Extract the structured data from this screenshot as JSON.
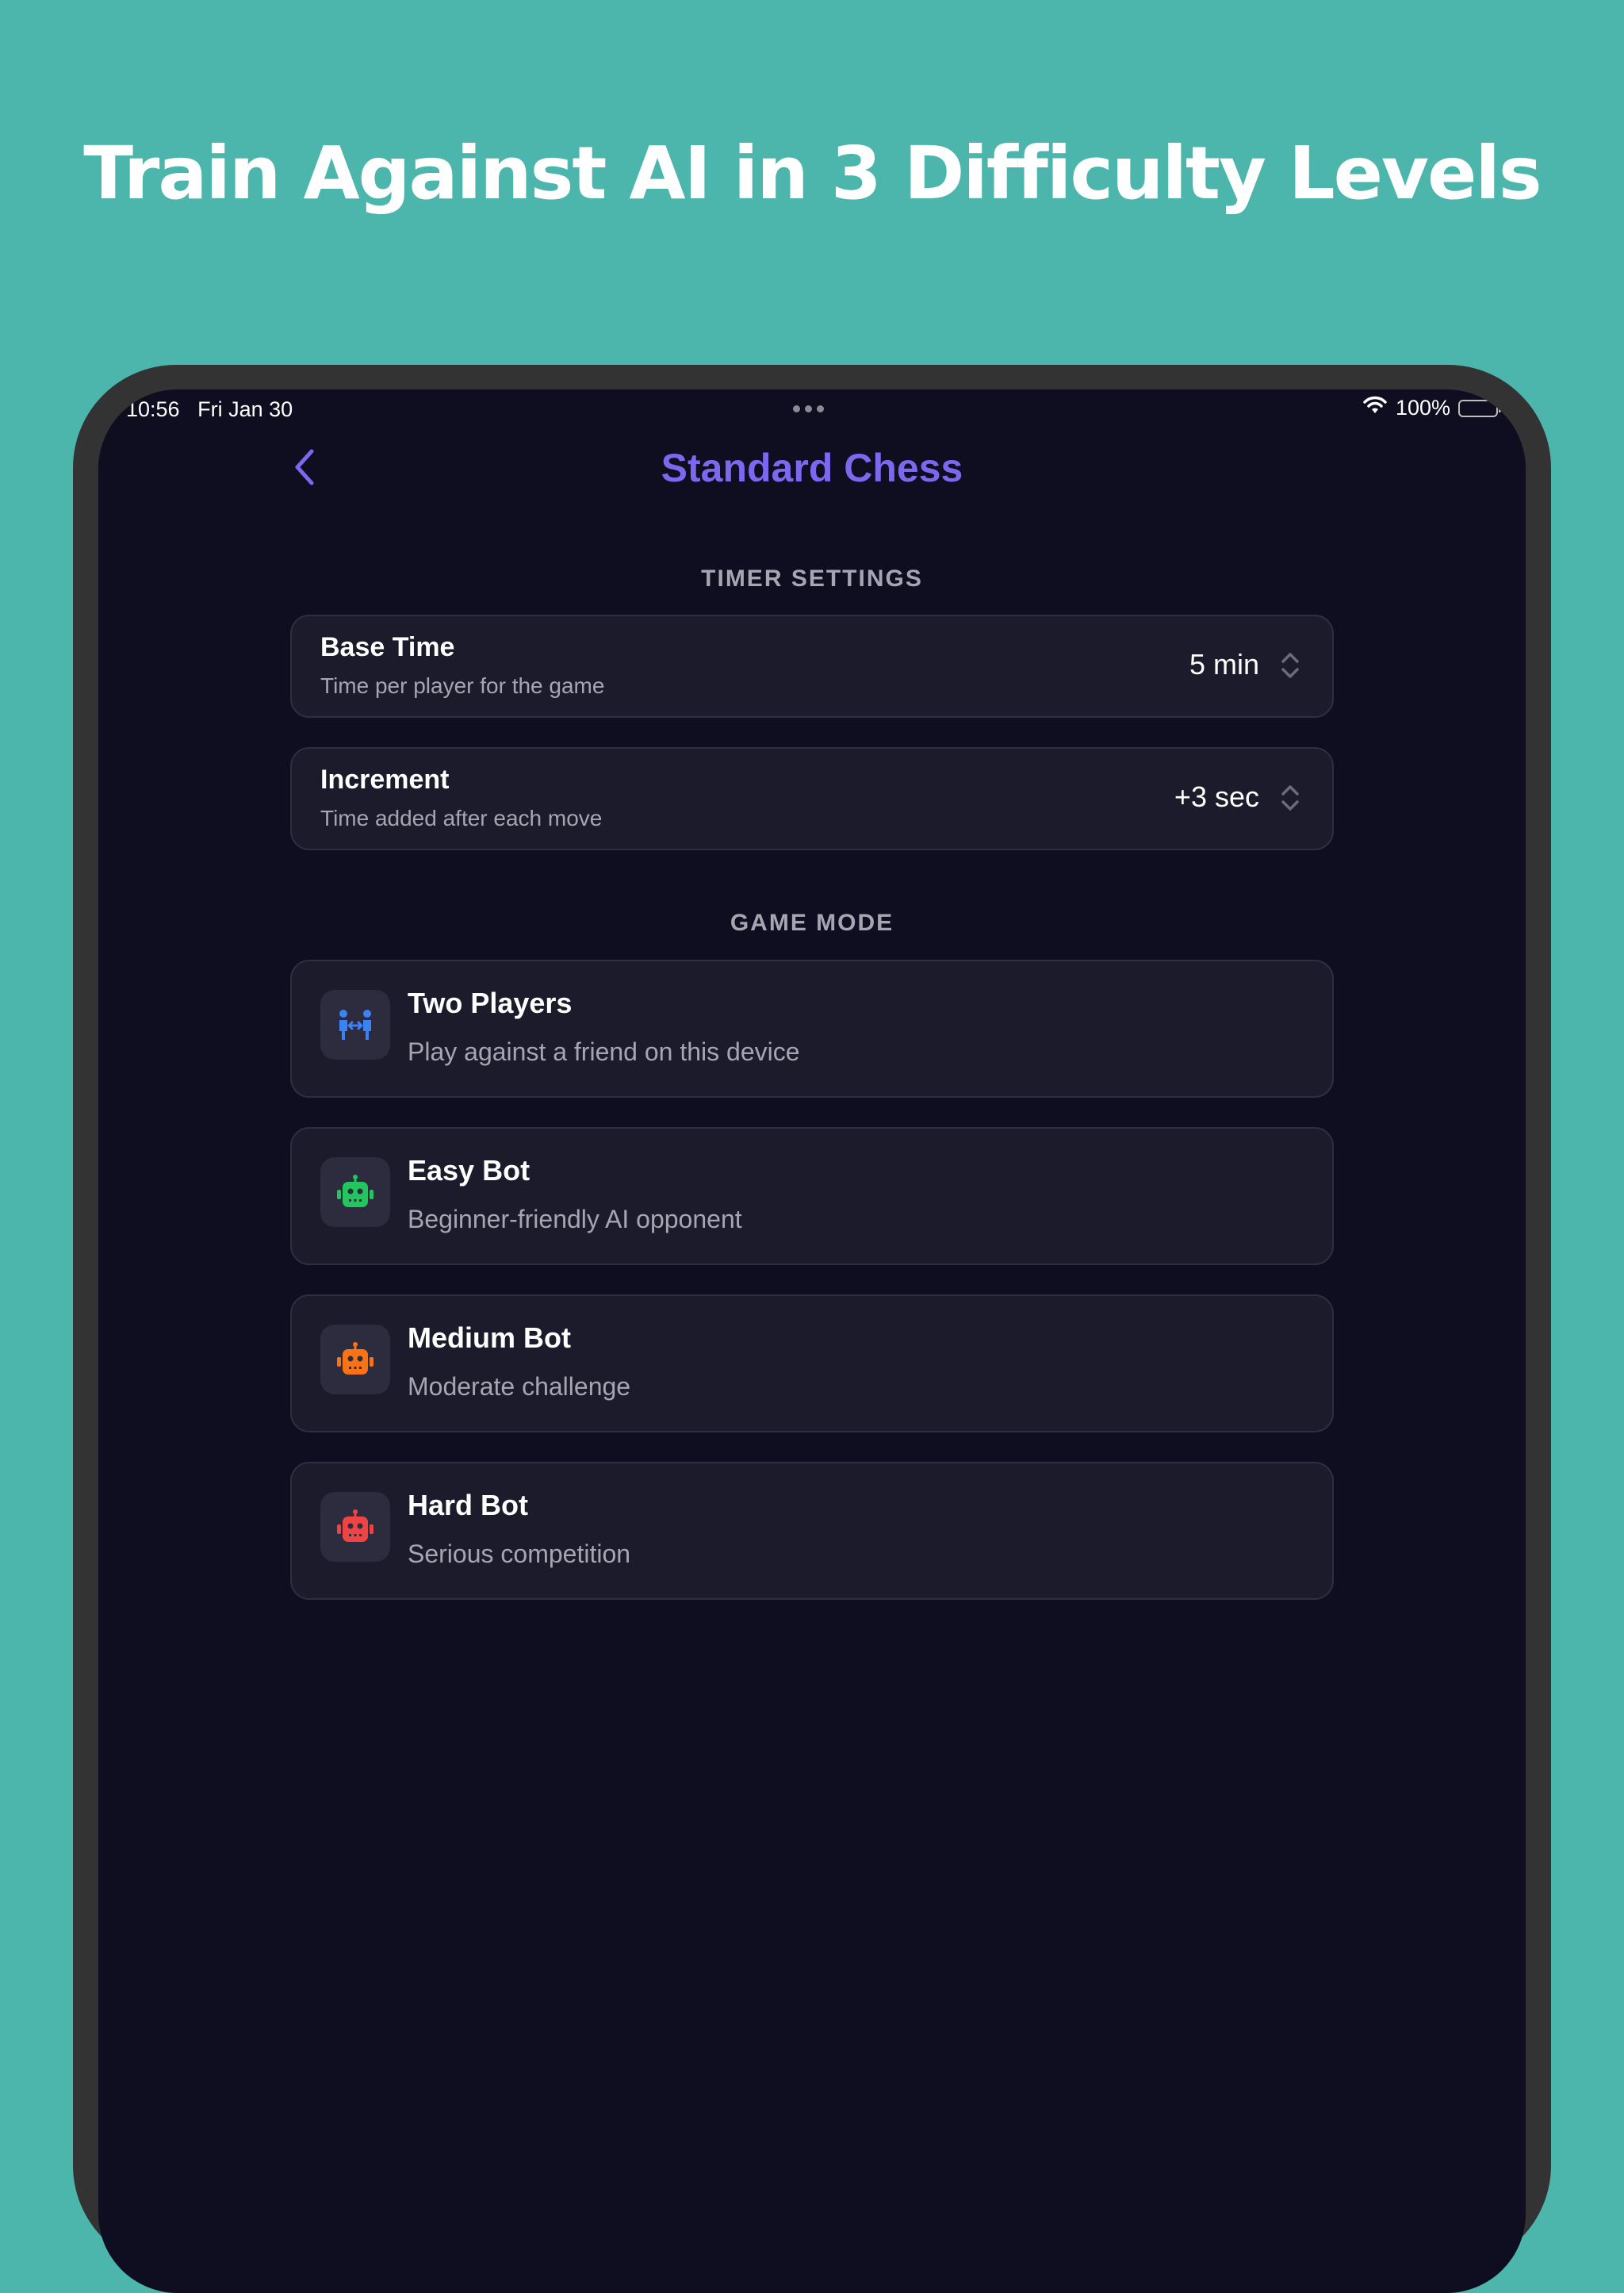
{
  "promo": {
    "headline": "Train Against AI in 3 Difficulty Levels"
  },
  "status_bar": {
    "time": "10:56",
    "date": "Fri Jan 30",
    "battery": "100%",
    "wifi_icon": "wifi-icon",
    "battery_icon": "battery-full-icon"
  },
  "nav": {
    "back_icon": "chevron-left-icon",
    "title": "Standard Chess"
  },
  "timer_settings": {
    "header": "TIMER SETTINGS",
    "base_time": {
      "title": "Base Time",
      "subtitle": "Time per player for the game",
      "value": "5 min"
    },
    "increment": {
      "title": "Increment",
      "subtitle": "Time added after each move",
      "value": "+3 sec"
    }
  },
  "game_mode": {
    "header": "GAME MODE",
    "modes": [
      {
        "title": "Two Players",
        "subtitle": "Play against a friend on this device",
        "icon": "two-players-icon",
        "color": "#3b82f6"
      },
      {
        "title": "Easy Bot",
        "subtitle": "Beginner-friendly AI opponent",
        "icon": "robot-icon",
        "color": "#22c55e"
      },
      {
        "title": "Medium Bot",
        "subtitle": "Moderate challenge",
        "icon": "robot-icon",
        "color": "#f97316"
      },
      {
        "title": "Hard Bot",
        "subtitle": "Serious competition",
        "icon": "robot-icon",
        "color": "#ef4444"
      }
    ]
  },
  "colors": {
    "background": "#4db6ac",
    "screen": "#0e0e20",
    "card": "#1b1b2c",
    "accent": "#7b68ee"
  }
}
